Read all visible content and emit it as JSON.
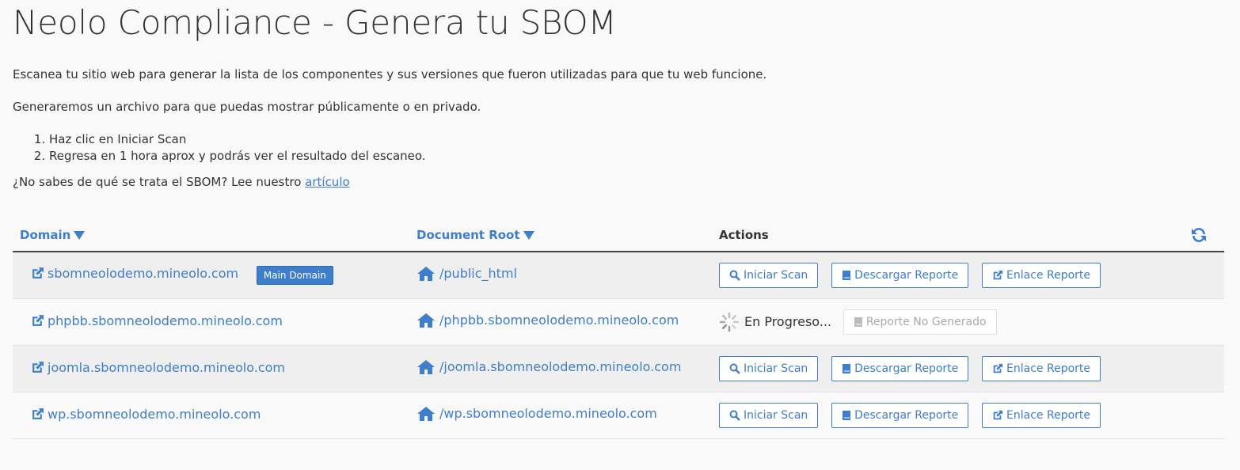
{
  "page": {
    "title": "Neolo Compliance - Genera tu SBOM",
    "intro1": "Escanea tu sitio web para generar la lista de los componentes y sus versiones que fueron utilizadas para que tu web funcione.",
    "intro2": "Generaremos un archivo para que puedas mostrar públicamente o en privado.",
    "steps": [
      "Haz clic en Iniciar Scan",
      "Regresa en 1 hora aprox y podrás ver el resultado del escaneo."
    ],
    "question": "¿No sabes de qué se trata el SBOM? Lee nuestro",
    "article_link": "artículo"
  },
  "table": {
    "headers": {
      "domain": "Domain",
      "document_root": "Document Root",
      "actions": "Actions"
    },
    "rows": [
      {
        "domain": "sbomneolodemo.mineolo.com",
        "badge": "Main Domain",
        "root": "/public_html",
        "status": "buttons"
      },
      {
        "domain": "phpbb.sbomneolodemo.mineolo.com",
        "badge": "",
        "root": "/phpbb.sbomneolodemo.mineolo.com",
        "status": "progress"
      },
      {
        "domain": "joomla.sbomneolodemo.mineolo.com",
        "badge": "",
        "root": "/joomla.sbomneolodemo.mineolo.com",
        "status": "buttons"
      },
      {
        "domain": "wp.sbomneolodemo.mineolo.com",
        "badge": "",
        "root": "/wp.sbomneolodemo.mineolo.com",
        "status": "buttons"
      }
    ]
  },
  "actions": {
    "scan": "Iniciar Scan",
    "download": "Descargar Reporte",
    "link": "Enlace Reporte",
    "in_progress": "En Progreso...",
    "not_generated": "Reporte No Generado"
  },
  "icons": {
    "external_link": "external-link-icon",
    "home": "home-icon",
    "search": "search-icon",
    "book": "book-icon",
    "refresh": "refresh-icon",
    "spinner": "spinner-icon"
  },
  "colors": {
    "accent": "#3e7ecb",
    "text": "#333333",
    "background": "#f9f9f9"
  }
}
